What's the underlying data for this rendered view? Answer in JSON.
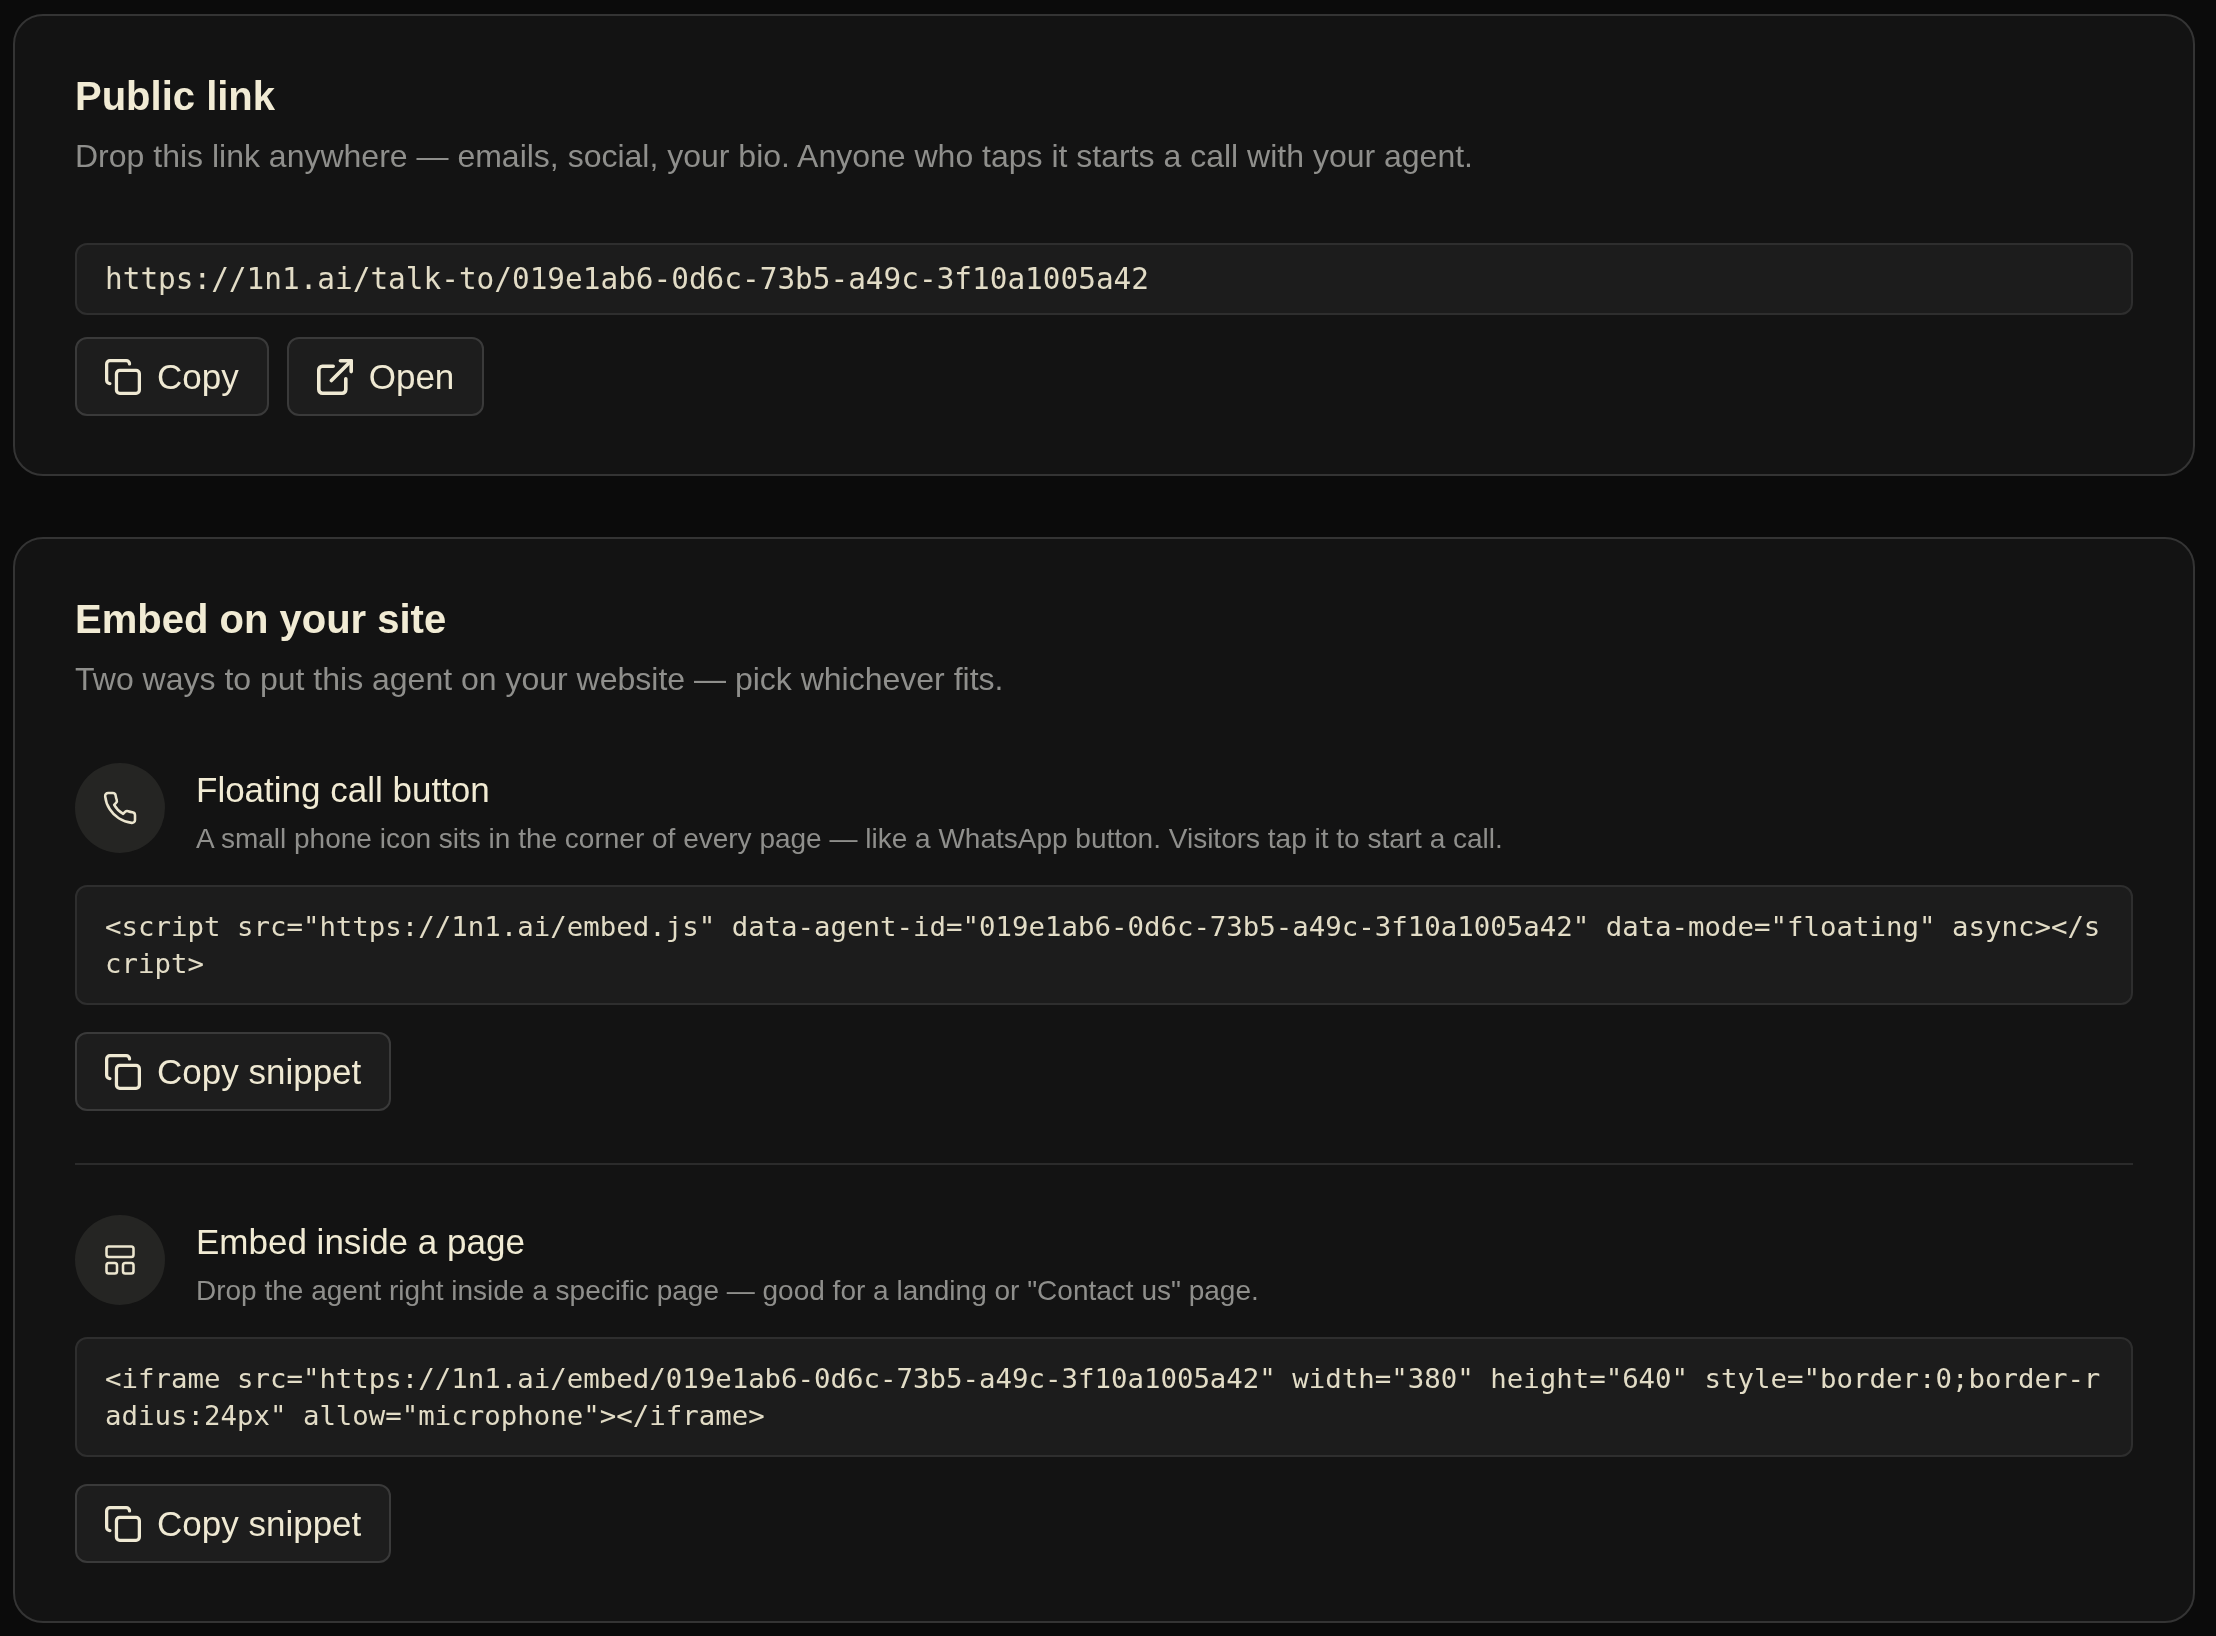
{
  "public_link": {
    "title": "Public link",
    "description": "Drop this link anywhere — emails, social, your bio. Anyone who taps it starts a call with your agent.",
    "url": "https://1n1.ai/talk-to/019e1ab6-0d6c-73b5-a49c-3f10a1005a42",
    "buttons": [
      {
        "kind": "copy",
        "label": "Copy"
      },
      {
        "kind": "open",
        "label": "Open"
      }
    ]
  },
  "embed": {
    "title": "Embed on your site",
    "description": "Two ways to put this agent on your website — pick whichever fits.",
    "options": [
      {
        "kind": "floating",
        "title": "Floating call button",
        "description": "A small phone icon sits in the corner of every page — like a WhatsApp button. Visitors tap it to start a call.",
        "snippet": "<script src=\"https://1n1.ai/embed.js\" data-agent-id=\"019e1ab6-0d6c-73b5-a49c-3f10a1005a42\" data-mode=\"floating\" async></script>",
        "button": {
          "kind": "copy",
          "label": "Copy snippet"
        }
      },
      {
        "kind": "inline",
        "title": "Embed inside a page",
        "description": "Drop the agent right inside a specific page — good for a landing or \"Contact us\" page.",
        "snippet": "<iframe src=\"https://1n1.ai/embed/019e1ab6-0d6c-73b5-a49c-3f10a1005a42\" width=\"380\" height=\"640\" style=\"border:0;border-radius:24px\" allow=\"microphone\"></iframe>",
        "button": {
          "kind": "copy",
          "label": "Copy snippet"
        }
      }
    ]
  }
}
